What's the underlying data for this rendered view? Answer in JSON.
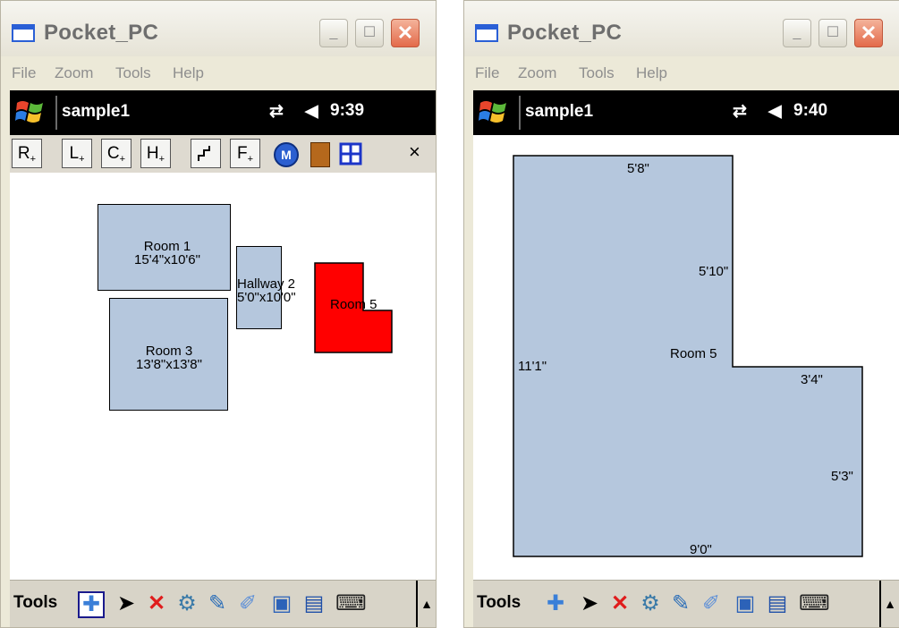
{
  "left": {
    "window_title": "Pocket_PC",
    "menu": [
      "File",
      "Zoom",
      "Tools",
      "Help"
    ],
    "task_title": "sample1",
    "clock": "9:39",
    "toolbar": [
      "R",
      "L",
      "C",
      "H",
      "",
      "F"
    ],
    "rooms": [
      {
        "name": "Room 1",
        "size": "15'4\"x10'6\""
      },
      {
        "name": "Hallway 2",
        "size": "5'0\"x10'0\""
      },
      {
        "name": "Room 3",
        "size": "13'8\"x13'8\""
      },
      {
        "name": "Room 5",
        "size": ""
      }
    ],
    "close_x": "×",
    "bottom_label": "Tools"
  },
  "right": {
    "window_title": "Pocket_PC",
    "menu": [
      "File",
      "Zoom",
      "Tools",
      "Help"
    ],
    "task_title": "sample1",
    "clock": "9:40",
    "room_name": "Room 5",
    "dimensions": {
      "top": "5'8\"",
      "inner_vertical": "5'10\"",
      "left": "11'1\"",
      "inner_horizontal": "3'4\"",
      "right": "5'3\"",
      "bottom": "9'0\""
    },
    "bottom_label": "Tools"
  },
  "colors": {
    "room_fill": "#b5c7dd",
    "selected_room": "#ff0000",
    "taskbar": "#000000"
  },
  "icons": [
    "windows-flag-icon",
    "connectivity-icon",
    "volume-icon",
    "add-icon",
    "pointer-icon",
    "delete-icon",
    "gear-icon",
    "edit-icon",
    "properties-icon",
    "window-icon",
    "save-icon",
    "keyboard-icon",
    "door-icon",
    "window-grid-icon",
    "m-circle-icon"
  ]
}
